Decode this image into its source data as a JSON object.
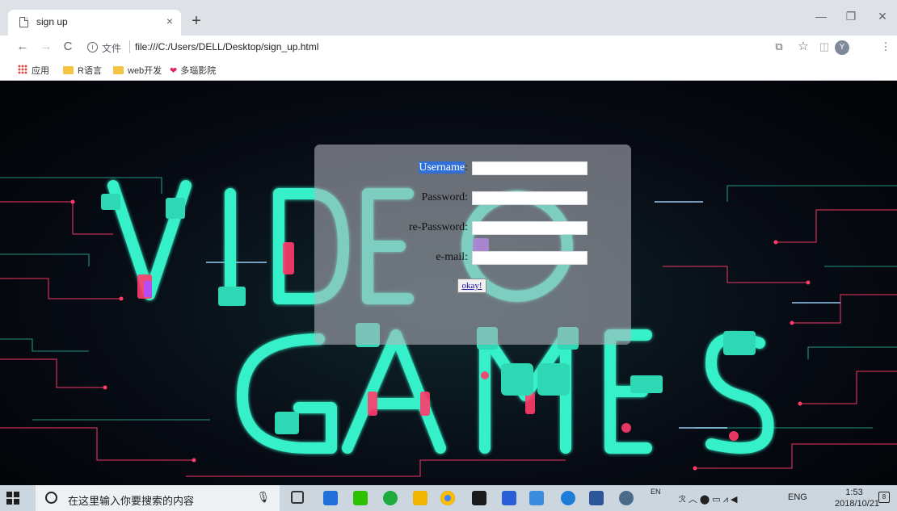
{
  "browser": {
    "tab_title": "sign up",
    "tab_close": "×",
    "new_tab": "+",
    "win_min": "—",
    "win_restore": "❐",
    "win_close": "✕",
    "nav_back": "←",
    "nav_forward": "→",
    "nav_reload": "C",
    "info_glyph": "i",
    "url_scheme_label": "文件",
    "url": "file:///C:/Users/DELL/Desktop/sign_up.html",
    "translate_glyph": "⧉",
    "star_glyph": "☆",
    "ext_glyph": "◫",
    "profile_initial": "Y",
    "menu_glyph": "⋮",
    "bookmarks": [
      {
        "label": "应用",
        "icon": "apps-grid-icon"
      },
      {
        "label": "R语言",
        "icon": "folder-icon"
      },
      {
        "label": "web开发",
        "icon": "folder-icon"
      },
      {
        "label": "多瑙影院",
        "icon": "heart-icon"
      }
    ]
  },
  "form": {
    "username_label": "Username",
    "password_label": "Password:",
    "repassword_label": "re-Password:",
    "email_label": "e-mail:",
    "submit_label": "okay!",
    "username_value": "",
    "password_value": "",
    "repassword_value": "",
    "email_value": ""
  },
  "background": {
    "art_text_top": "VIDEO",
    "art_text_bottom": "GAMES",
    "accent_cyan": "#35f0c8",
    "accent_pink": "#ff3b6b",
    "accent_purple": "#b04dff"
  },
  "taskbar": {
    "search_placeholder": "在这里输入你要搜索的内容",
    "mic_glyph": "🎙",
    "tray_lang_small": "EN",
    "tray_text": "ENG",
    "time": "1:53",
    "date": "2018/10/21",
    "notification_count": "8",
    "tray_glyphs": "ℛ ︿ ⬤ ▭ ⩘ ◀ ",
    "apps": [
      "task-view",
      "bluetooth",
      "wechat",
      "music",
      "file-explorer",
      "chrome",
      "mail",
      "media",
      "network",
      "edge",
      "word",
      "globe"
    ]
  }
}
